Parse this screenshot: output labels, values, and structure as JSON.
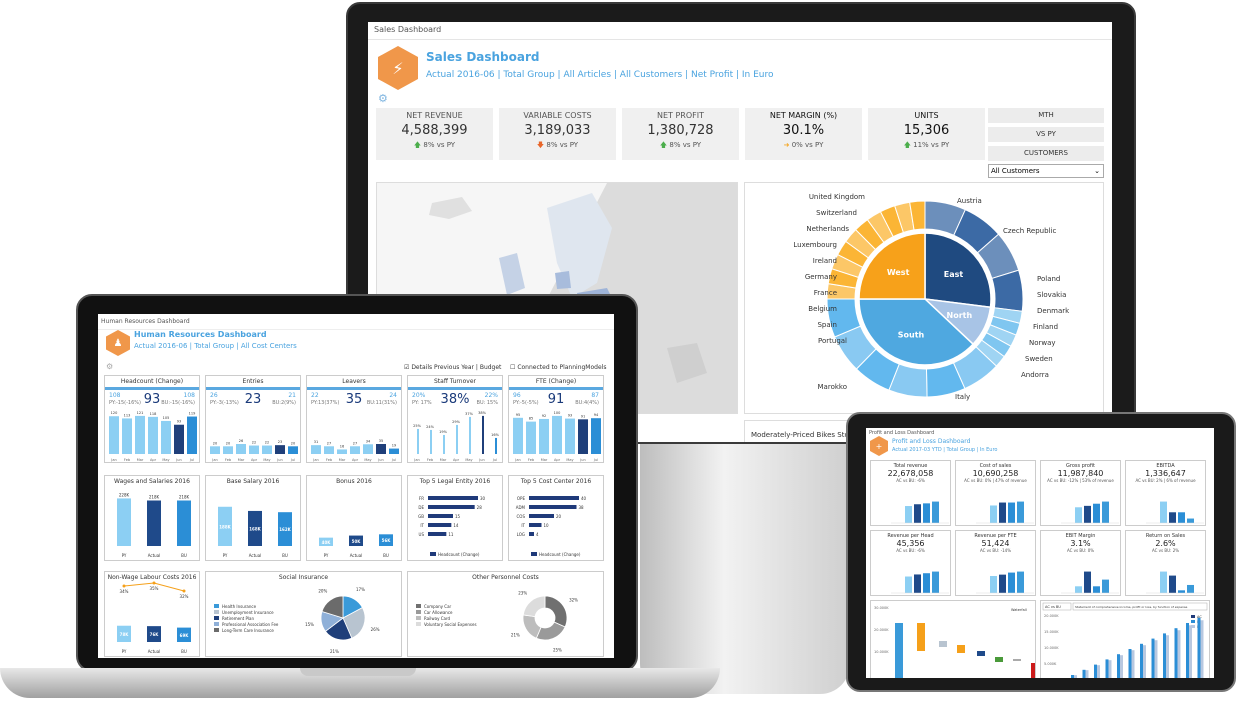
{
  "monitor": {
    "window_title": "Sales Dashboard",
    "title": "Sales Dashboard",
    "subtitle": "Actual 2016-06 | Total Group | All Articles | All Customers | Net Profit | In Euro",
    "kpis": [
      {
        "label": "NET REVENUE",
        "value": "4,588,399",
        "delta": "8% vs PY",
        "trend": "up"
      },
      {
        "label": "VARIABLE COSTS",
        "value": "3,189,033",
        "delta": "8% vs PY",
        "trend": "down"
      },
      {
        "label": "NET PROFIT",
        "value": "1,380,728",
        "delta": "8% vs PY",
        "trend": "up"
      },
      {
        "label": "NET MARGIN (%)",
        "value": "30.1%",
        "delta": "0% vs PY",
        "trend": "flat"
      },
      {
        "label": "UNITS",
        "value": "15,306",
        "delta": "11% vs PY",
        "trend": "up"
      }
    ],
    "side_buttons": [
      "MTH",
      "VS PY",
      "CUSTOMERS"
    ],
    "customer_select": "All Customers",
    "bikes_label": "Moderately-Priced Bikes Sto",
    "sunburst": {
      "regions": [
        {
          "name": "East",
          "color": "#1f4a80"
        },
        {
          "name": "North",
          "color": "#a8c4e6"
        },
        {
          "name": "South",
          "color": "#4fa8e0"
        },
        {
          "name": "West",
          "color": "#f7a11a"
        }
      ],
      "countries_left": [
        "United Kingdom",
        "Switzerland",
        "Netherlands",
        "Luxembourg",
        "Ireland",
        "Germany",
        "France",
        "Belgium",
        "Spain",
        "Portugal",
        "Marokko"
      ],
      "countries_right": [
        "Austria",
        "Czech Republic",
        "Poland",
        "Slovakia",
        "Denmark",
        "Finland",
        "Norway",
        "Sweden",
        "Andorra",
        "Italy"
      ]
    }
  },
  "laptop": {
    "window_title": "Human Resources Dashboard",
    "title": "Human Resources Dashboard",
    "subtitle": "Actual 2016-06 | Total Group | All Cost Centers",
    "check_details": "Details Previous Year | Budget",
    "check_planning": "Connected to PlanningModels",
    "months": [
      "Jan",
      "Feb",
      "Mar",
      "Apr",
      "May",
      "Jun",
      "Jul"
    ],
    "kpi_cards": [
      {
        "title": "Headcount (Change)",
        "value": "93",
        "left": "108",
        "left_sub": "PY:-15(-16%)",
        "right": "108",
        "right_sub": "BU:-15(-16%)",
        "bars": [
          120,
          113,
          121,
          118,
          105,
          93,
          119
        ]
      },
      {
        "title": "Entries",
        "value": "23",
        "left": "26",
        "left_sub": "PY:-3(-13%)",
        "right": "21",
        "right_sub": "BU:2(9%)",
        "bars": [
          20,
          20,
          26,
          22,
          22,
          23,
          20
        ]
      },
      {
        "title": "Leavers",
        "value": "35",
        "left": "22",
        "left_sub": "PY:13(37%)",
        "right": "24",
        "right_sub": "BU:11(31%)",
        "bars": [
          31,
          27,
          16,
          27,
          34,
          35,
          19
        ]
      },
      {
        "title": "Staff Turnover",
        "value": "38%",
        "left": "20%",
        "left_sub": "PY: 17%",
        "right": "22%",
        "right_sub": "BU: 15%",
        "bars": [
          25,
          24,
          19,
          29,
          37,
          38,
          16
        ]
      },
      {
        "title": "FTE (Change)",
        "value": "91",
        "left": "96",
        "left_sub": "PY:-5(-5%)",
        "right": "87",
        "right_sub": "BU:4(4%)",
        "bars": [
          95,
          85,
          92,
          100,
          93,
          91,
          94
        ]
      }
    ],
    "wages": {
      "title": "Wages and Salaries 2016",
      "cats": [
        "PY",
        "Actual",
        "BU"
      ],
      "values": [
        228,
        218,
        218
      ],
      "labels": [
        "228K",
        "218K",
        "218K"
      ]
    },
    "base_salary": {
      "title": "Base Salary 2016",
      "cats": [
        "PY",
        "Actual",
        "BU"
      ],
      "values": [
        188,
        168,
        162
      ],
      "labels": [
        "188K",
        "168K",
        "162K"
      ]
    },
    "bonus": {
      "title": "Bonus 2016",
      "cats": [
        "PY",
        "Actual",
        "BU"
      ],
      "values": [
        40,
        50,
        56
      ],
      "labels": [
        "40K",
        "50K",
        "56K"
      ]
    },
    "legal_entity": {
      "title": "Top 5 Legal Entity 2016",
      "cats": [
        "FR",
        "DE",
        "GB",
        "IT",
        "US"
      ],
      "values": [
        30,
        28,
        15,
        14,
        11
      ],
      "legend": "Headcount (Change)"
    },
    "cost_center": {
      "title": "Top 5 Cost Center 2016",
      "cats": [
        "OPE",
        "ADM",
        "COS",
        "IT",
        "LOG"
      ],
      "values": [
        40,
        38,
        20,
        10,
        4
      ],
      "legend": "Headcount (Change)"
    },
    "non_wage": {
      "title": "Non-Wage Labour Costs 2016",
      "cats": [
        "PY",
        "Actual",
        "BU"
      ],
      "values": [
        78,
        76,
        69
      ],
      "labels": [
        "78K",
        "76K",
        "69K"
      ],
      "pct": [
        "34%",
        "35%",
        "32%"
      ]
    },
    "social": {
      "title": "Social Insurance",
      "legend": [
        "Health Insurance",
        "Unemployment Insurance",
        "Retirement Plan",
        "Professional Association Fee",
        "Long-Term Care Insurance"
      ],
      "values": [
        17,
        26,
        21,
        15,
        20
      ],
      "colors": [
        "#3a9ad9",
        "#b8c4d0",
        "#1f3f7a",
        "#8fb0d8",
        "#6b6b6b"
      ]
    },
    "other": {
      "title": "Other Personnel Costs",
      "legend": [
        "Company Car",
        "Car Allowance",
        "Railway Card",
        "Voluntary Social Expenses"
      ],
      "values": [
        32,
        25,
        21,
        23
      ],
      "colors": [
        "#707070",
        "#9a9a9a",
        "#bdbdbd",
        "#dcdcdc"
      ]
    }
  },
  "tablet": {
    "window_title": "Profit and Loss Dashboard",
    "title": "Profit and Loss Dashboard",
    "subtitle": "Actual 2017-03 YTD | Total Group | In Euro",
    "cards": [
      {
        "title": "Total revenue",
        "value": "22,678,058",
        "delta": "AC vs BU: -6%",
        "bars": [
          19,
          21,
          22,
          24
        ]
      },
      {
        "title": "Cost of sales",
        "value": "10,690,258",
        "delta": "AC vs BU: 0%  |  47% of revenue",
        "bars": [
          9,
          10.5,
          10.5,
          11
        ]
      },
      {
        "title": "Gross profit",
        "value": "11,987,840",
        "delta": "AC vs BU: -12%  |  53% of revenue",
        "bars": [
          11,
          12,
          13.5,
          15
        ]
      },
      {
        "title": "EBITDA",
        "value": "1,336,647",
        "delta": "AC vs BU: 2%  |  6% of revenue",
        "bars": [
          2.4,
          1.2,
          1.2,
          0.5
        ]
      },
      {
        "title": "Revenue per Head",
        "value": "45,356",
        "delta": "AC vs BU: -6%",
        "bars": [
          40,
          45,
          48,
          52
        ]
      },
      {
        "title": "Revenue per FTE",
        "value": "51,424",
        "delta": "AC vs BU: -14%",
        "bars": [
          50,
          54,
          60,
          63
        ]
      },
      {
        "title": "EBIT Margin",
        "value": "3.1%",
        "delta": "AC vs BU: 0%",
        "bars": [
          1.0,
          3.2,
          1.0,
          2.0
        ]
      },
      {
        "title": "Return on Sales",
        "value": "2.6%",
        "delta": "AC vs BU: 2%",
        "bars": [
          3.2,
          2.6,
          0.4,
          1.2
        ]
      }
    ],
    "waterfall_label": "Waterfall",
    "waterfall_axis": [
      "30.000K",
      "20.000K",
      "10.000K"
    ],
    "selector_left": "AC vs BU",
    "selector_text": "Statement of comprehensive income, profit or loss, by function of expense",
    "bars_legend": [
      "AC",
      "BU",
      "PY"
    ],
    "bars_axis": [
      "20.000K",
      "15.000K",
      "10.000K",
      "5.000K"
    ]
  }
}
